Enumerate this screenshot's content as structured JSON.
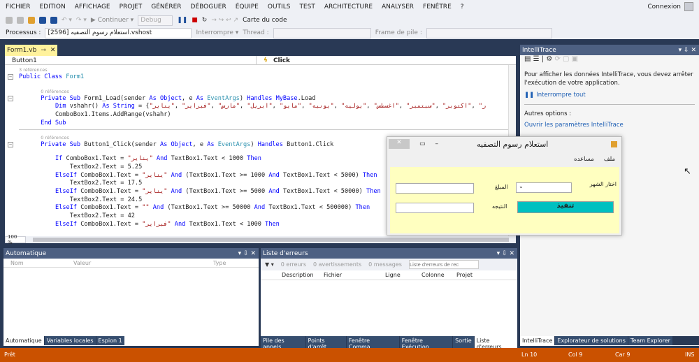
{
  "menu": [
    "FICHIER",
    "EDITION",
    "AFFICHAGE",
    "PROJET",
    "GÉNÉRER",
    "DÉBOGUER",
    "ÉQUIPE",
    "OUTILS",
    "TEST",
    "ARCHITECTURE",
    "ANALYSER",
    "FENÊTRE",
    "?"
  ],
  "signin": "Connexion",
  "toolbar1": {
    "continue": "▶ Continuer ▾",
    "config": "Debug",
    "codemap": "Carte du code"
  },
  "toolbar2": {
    "process_label": "Processus :",
    "process_value": "[2596] استعلام رسوم التصفيه.vshost",
    "break": "Interrompre ▾",
    "thread": "Thread :",
    "frame": "Frame de pile :"
  },
  "doc_tab": {
    "label": "Form1.vb",
    "pin": "⇾",
    "close": "✕"
  },
  "nav": {
    "object": "Button1",
    "event": "Click"
  },
  "code": [
    [
      [
        "ref",
        "3 références"
      ]
    ],
    [
      [
        "kw",
        "Public Class "
      ],
      [
        "ty",
        "Form1"
      ]
    ],
    [],
    [
      [
        "ref",
        "0 références"
      ]
    ],
    [
      [
        "kw",
        "Private Sub "
      ],
      [
        "tx",
        "Form1_Load(sender "
      ],
      [
        "kw",
        "As Object"
      ],
      [
        "tx",
        ", e "
      ],
      [
        "kw",
        "As "
      ],
      [
        "ty",
        "EventArgs"
      ],
      [
        "tx",
        ") "
      ],
      [
        "kw",
        "Handles MyBase"
      ],
      [
        "tx",
        ".Load"
      ]
    ],
    [
      [
        "kw",
        "Dim "
      ],
      [
        "tx",
        "vshahr() "
      ],
      [
        "kw",
        "As String"
      ],
      [
        "tx",
        " = {"
      ],
      [
        "st",
        "\"يناير\""
      ],
      [
        "tx",
        ", "
      ],
      [
        "st",
        "\"فبراير\""
      ],
      [
        "tx",
        ", "
      ],
      [
        "st",
        "\"مارس\""
      ],
      [
        "tx",
        ", "
      ],
      [
        "st",
        "\"ابريل\""
      ],
      [
        "tx",
        ", "
      ],
      [
        "st",
        "\"مايو\""
      ],
      [
        "tx",
        ", "
      ],
      [
        "st",
        "\"يونيه\""
      ],
      [
        "tx",
        ", "
      ],
      [
        "st",
        "\"يوليه\""
      ],
      [
        "tx",
        ", "
      ],
      [
        "st",
        "\"اغسطس\""
      ],
      [
        "tx",
        ", "
      ],
      [
        "st",
        "\"سبتمبر\""
      ],
      [
        "tx",
        ", "
      ],
      [
        "st",
        "\"اكتوبر\""
      ],
      [
        "tx",
        ", "
      ],
      [
        "st",
        "\"ر"
      ]
    ],
    [
      [
        "tx",
        "ComboBox1.Items.AddRange(vshahr)"
      ]
    ],
    [
      [
        "kw",
        "End Sub"
      ]
    ],
    [],
    [
      [
        "ref",
        "0 références"
      ]
    ],
    [
      [
        "kw",
        "Private Sub "
      ],
      [
        "tx",
        "Button1_Click(sender "
      ],
      [
        "kw",
        "As Object"
      ],
      [
        "tx",
        ", e "
      ],
      [
        "kw",
        "As "
      ],
      [
        "ty",
        "EventArgs"
      ],
      [
        "tx",
        ") "
      ],
      [
        "kw",
        "Handles "
      ],
      [
        "tx",
        "Button1.Click"
      ]
    ],
    [],
    [
      [
        "kw",
        "If "
      ],
      [
        "tx",
        "ComboBox1.Text = "
      ],
      [
        "st",
        "\"يناير\""
      ],
      [
        "kw",
        " And "
      ],
      [
        "tx",
        "TextBox1.Text < 1000 "
      ],
      [
        "kw",
        "Then"
      ]
    ],
    [
      [
        "tx",
        "TextBox2.Text = 5.25"
      ]
    ],
    [
      [
        "kw",
        "ElseIf "
      ],
      [
        "tx",
        "ComboBox1.Text = "
      ],
      [
        "st",
        "\"يناير\""
      ],
      [
        "kw",
        " And "
      ],
      [
        "tx",
        "(TextBox1.Text >= 1000 "
      ],
      [
        "kw",
        "And "
      ],
      [
        "tx",
        "TextBox1.Text < 5000) "
      ],
      [
        "kw",
        "Then"
      ]
    ],
    [
      [
        "tx",
        "TextBox2.Text = 17.5"
      ]
    ],
    [
      [
        "kw",
        "ElseIf "
      ],
      [
        "tx",
        "ComboBox1.Text = "
      ],
      [
        "st",
        "\"يناير\""
      ],
      [
        "kw",
        " And "
      ],
      [
        "tx",
        "(TextBox1.Text >= 5000 "
      ],
      [
        "kw",
        "And "
      ],
      [
        "tx",
        "TextBox1.Text < 50000) "
      ],
      [
        "kw",
        "Then"
      ]
    ],
    [
      [
        "tx",
        "TextBox2.Text = 24.5"
      ]
    ],
    [
      [
        "kw",
        "ElseIf "
      ],
      [
        "tx",
        "ComboBox1.Text = "
      ],
      [
        "st",
        "\"\""
      ],
      [
        "kw",
        " And "
      ],
      [
        "tx",
        "(TextBox1.Text >= 50000 "
      ],
      [
        "kw",
        "And "
      ],
      [
        "tx",
        "TextBox1.Text < 500000) "
      ],
      [
        "kw",
        "Then"
      ]
    ],
    [
      [
        "tx",
        "TextBox2.Text = 42"
      ]
    ],
    [
      [
        "kw",
        "ElseIf "
      ],
      [
        "tx",
        "ComboBox1.Text = "
      ],
      [
        "st",
        "\"فبراير\""
      ],
      [
        "kw",
        " And "
      ],
      [
        "tx",
        "TextBox1.Text < 1000 "
      ],
      [
        "kw",
        "Then"
      ]
    ]
  ],
  "zoom": "100 %",
  "autos": {
    "title": "Automatique",
    "cols": [
      "Nom",
      "Valeur",
      "Type"
    ],
    "tabs": [
      "Automatique",
      "Variables locales",
      "Espion 1"
    ]
  },
  "errors": {
    "title": "Liste d'erreurs",
    "errors": "0 erreurs",
    "warnings": "0 avertissements",
    "messages": "0 messages",
    "search_placeholder": "Liste d'erreurs de rec",
    "cols": [
      "Description",
      "Fichier",
      "Ligne",
      "Colonne",
      "Projet"
    ],
    "tabs": [
      "Pile des appels",
      "Points d'arrêt",
      "Fenêtre Comma...",
      "Fenêtre Exécution",
      "Sortie",
      "Liste d'erreurs"
    ]
  },
  "intellitrace": {
    "title": "IntelliTrace",
    "message": "Pour afficher les données IntelliTrace, vous devez arrêter l'exécution de votre application.",
    "break_all": "Interrompre tout",
    "other": "Autres options :",
    "open_settings": "Ouvrir les paramètres IntelliTrace",
    "tabs": [
      "IntelliTrace",
      "Explorateur de solutions",
      "Team Explorer"
    ]
  },
  "form": {
    "title": "استعلام رسوم التصفيه",
    "menu": [
      "ملف",
      "مساعده"
    ],
    "month_label": "اختار الشهر",
    "amount_label": "المبلغ",
    "result_label": "النتيجه",
    "execute": "تنفيذ",
    "accent": "#00c0c0"
  },
  "status": {
    "ready": "Prêt",
    "ln": "Ln 10",
    "col": "Col 9",
    "car": "Car 9",
    "ins": "INS",
    "color": "#ca5100"
  }
}
